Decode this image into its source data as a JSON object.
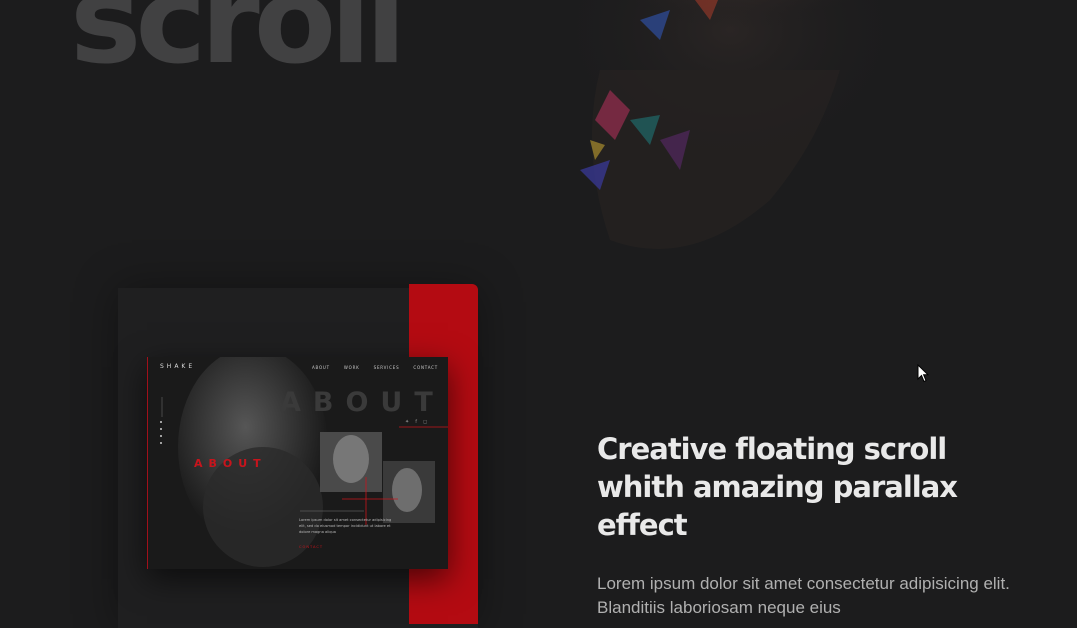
{
  "hero": {
    "word": "scroll"
  },
  "mockup": {
    "logo": "SHAKE",
    "nav": [
      "ABOUT",
      "WORK",
      "SERVICES",
      "CONTACT"
    ],
    "ghost_title": "ABOUT",
    "about_title": "ABOUT",
    "body": "Lorem ipsum dolor sit amet consectetur adipisicing elit, sed do eiusmod tempor incididunt ut labore et dolore magna aliqua",
    "link": "CONTACT",
    "social_icons": [
      "twitter-icon",
      "facebook-icon",
      "instagram-icon"
    ]
  },
  "feature": {
    "headline": "Creative floating scroll whith amazing parallax effect",
    "body": "Lorem ipsum dolor sit amet consectetur adipisicing elit. Blanditiis laboriosam neque eius"
  },
  "colors": {
    "accent": "#b40b12",
    "background": "#1c1c1d"
  }
}
